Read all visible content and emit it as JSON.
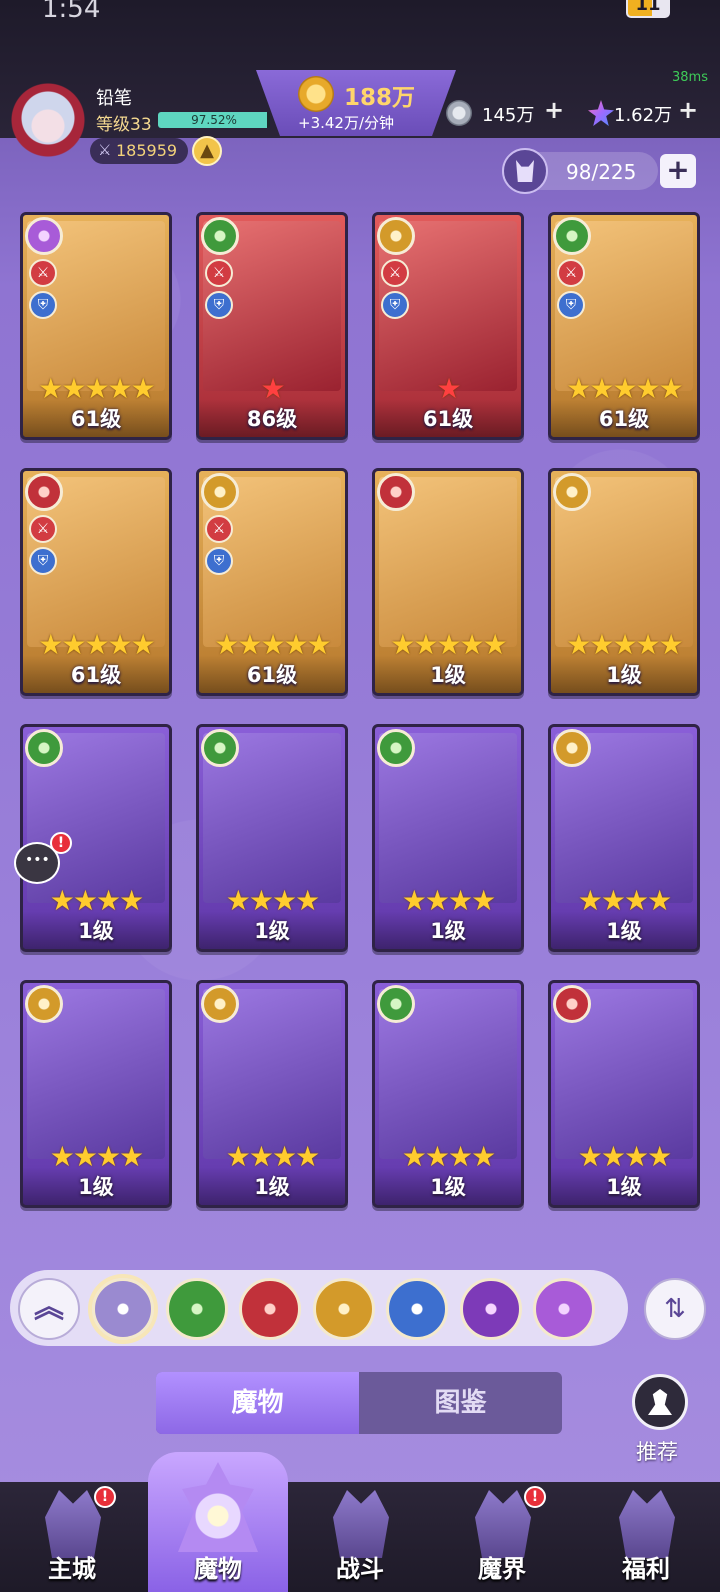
{
  "status": {
    "time": "1:54",
    "battery": "11"
  },
  "ping": "38ms",
  "player": {
    "name": "铅笔",
    "level_label": "等级33",
    "exp_percent": 97.52,
    "exp_text": "97.52%",
    "power": "185959"
  },
  "currency": {
    "gold": "188万",
    "gold_rate": "+3.42万/分钟",
    "silver": "145万",
    "gems": "1.62万"
  },
  "capacity": "98/225",
  "cards": [
    {
      "level": "61级",
      "stars": 5,
      "star_color": "gold",
      "frame": "gold",
      "faction": "wind",
      "atk": true,
      "def": true
    },
    {
      "level": "86级",
      "stars": 1,
      "star_color": "red",
      "frame": "red",
      "faction": "nature",
      "atk": true,
      "def": true
    },
    {
      "level": "61级",
      "stars": 1,
      "star_color": "red",
      "frame": "red",
      "faction": "time",
      "atk": true,
      "def": true
    },
    {
      "level": "61级",
      "stars": 5,
      "star_color": "gold",
      "frame": "gold",
      "faction": "nature",
      "atk": true,
      "def": true
    },
    {
      "level": "61级",
      "stars": 5,
      "star_color": "gold",
      "frame": "gold",
      "faction": "demon",
      "atk": true,
      "def": true
    },
    {
      "level": "61级",
      "stars": 5,
      "star_color": "gold",
      "frame": "gold",
      "faction": "time",
      "atk": true,
      "def": true
    },
    {
      "level": "1级",
      "stars": 5,
      "star_color": "gold",
      "frame": "gold",
      "faction": "demon",
      "atk": false,
      "def": false
    },
    {
      "level": "1级",
      "stars": 5,
      "star_color": "gold",
      "frame": "gold",
      "faction": "time",
      "atk": false,
      "def": false
    },
    {
      "level": "1级",
      "stars": 4,
      "star_color": "gold",
      "frame": "purple",
      "faction": "nature",
      "atk": false,
      "def": false
    },
    {
      "level": "1级",
      "stars": 4,
      "star_color": "gold",
      "frame": "purple",
      "faction": "nature",
      "atk": false,
      "def": false
    },
    {
      "level": "1级",
      "stars": 4,
      "star_color": "gold",
      "frame": "purple",
      "faction": "nature",
      "atk": false,
      "def": false
    },
    {
      "level": "1级",
      "stars": 4,
      "star_color": "gold",
      "frame": "purple",
      "faction": "time",
      "atk": false,
      "def": false
    },
    {
      "level": "1级",
      "stars": 4,
      "star_color": "gold",
      "frame": "purple",
      "faction": "time",
      "atk": false,
      "def": false
    },
    {
      "level": "1级",
      "stars": 4,
      "star_color": "gold",
      "frame": "purple",
      "faction": "time",
      "atk": false,
      "def": false
    },
    {
      "level": "1级",
      "stars": 4,
      "star_color": "gold",
      "frame": "purple",
      "faction": "nature",
      "atk": false,
      "def": false
    },
    {
      "level": "1级",
      "stars": 4,
      "star_color": "gold",
      "frame": "purple",
      "faction": "demon",
      "atk": false,
      "def": false
    }
  ],
  "filters": [
    {
      "name": "all-filter-icon",
      "faction": "all"
    },
    {
      "name": "nature-filter-icon",
      "faction": "nature"
    },
    {
      "name": "demon-filter-icon",
      "faction": "demon"
    },
    {
      "name": "time-filter-icon",
      "faction": "time"
    },
    {
      "name": "dragon-filter-icon",
      "faction": "dragon"
    },
    {
      "name": "eye-filter-icon",
      "faction": "eye"
    },
    {
      "name": "wind-filter-icon",
      "faction": "wind"
    }
  ],
  "tabs": {
    "monsters": "魔物",
    "codex": "图鉴"
  },
  "recommend_label": "推荐",
  "nav": {
    "main_city": "主城",
    "monsters": "魔物",
    "battle": "战斗",
    "demon_realm": "魔界",
    "welfare": "福利"
  },
  "colors": {
    "accent": "#8d68e6",
    "gold_text": "#ffd66b",
    "exp_fill": "#5ed6c0",
    "star": "#ffcc2e",
    "alert": "#e8303a"
  }
}
